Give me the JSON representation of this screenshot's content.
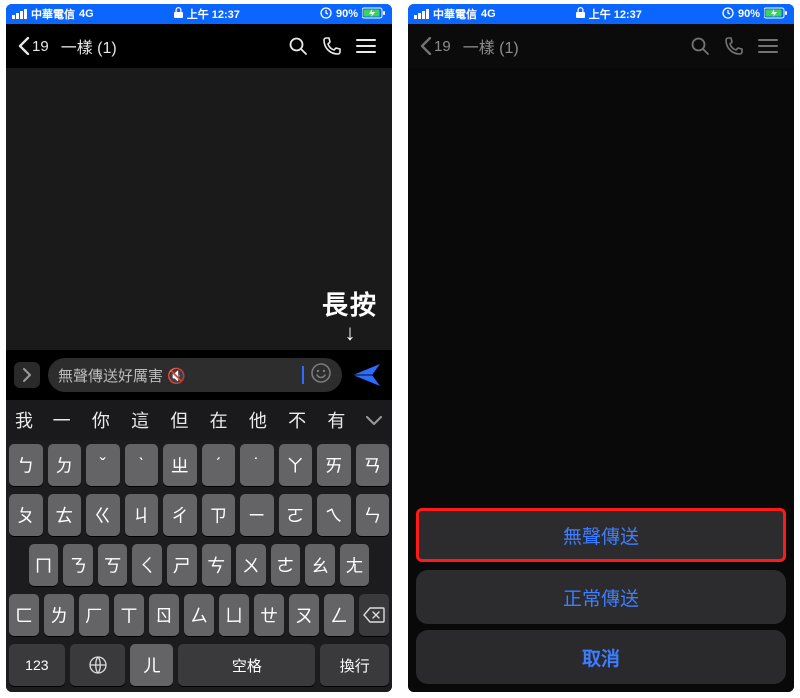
{
  "status": {
    "carrier": "中華電信",
    "network": "4G",
    "time": "上午 12:37",
    "battery_pct": "90%"
  },
  "nav": {
    "back_count": "19",
    "title": "一樣 (1)"
  },
  "annotation": {
    "label": "長按",
    "arrow": "↓"
  },
  "input": {
    "message": "無聲傳送好厲害 🔇"
  },
  "suggestions": [
    "我",
    "一",
    "你",
    "這",
    "但",
    "在",
    "他",
    "不",
    "有"
  ],
  "keyboard": {
    "rows": [
      [
        "ㄅ",
        "ㄉ",
        "ˇ",
        "ˋ",
        "ㄓ",
        "ˊ",
        "˙",
        "ㄚ",
        "ㄞ",
        "ㄢ"
      ],
      [
        "ㄆ",
        "ㄊ",
        "ㄍ",
        "ㄐ",
        "ㄔ",
        "ㄗ",
        "ㄧ",
        "ㄛ",
        "ㄟ",
        "ㄣ"
      ],
      [
        "ㄇ",
        "ㄋ",
        "ㄎ",
        "ㄑ",
        "ㄕ",
        "ㄘ",
        "ㄨ",
        "ㄜ",
        "ㄠ",
        "ㄤ"
      ],
      [
        "ㄈ",
        "ㄌ",
        "ㄏ",
        "ㄒ",
        "ㄖ",
        "ㄙ",
        "ㄩ",
        "ㄝ",
        "ㄡ",
        "ㄥ"
      ],
      [
        "ㄦ"
      ]
    ],
    "fn123": "123",
    "globe": "🌐",
    "space": "空格",
    "ret": "換行"
  },
  "sheet": {
    "silent": "無聲傳送",
    "normal": "正常傳送",
    "cancel": "取消"
  }
}
